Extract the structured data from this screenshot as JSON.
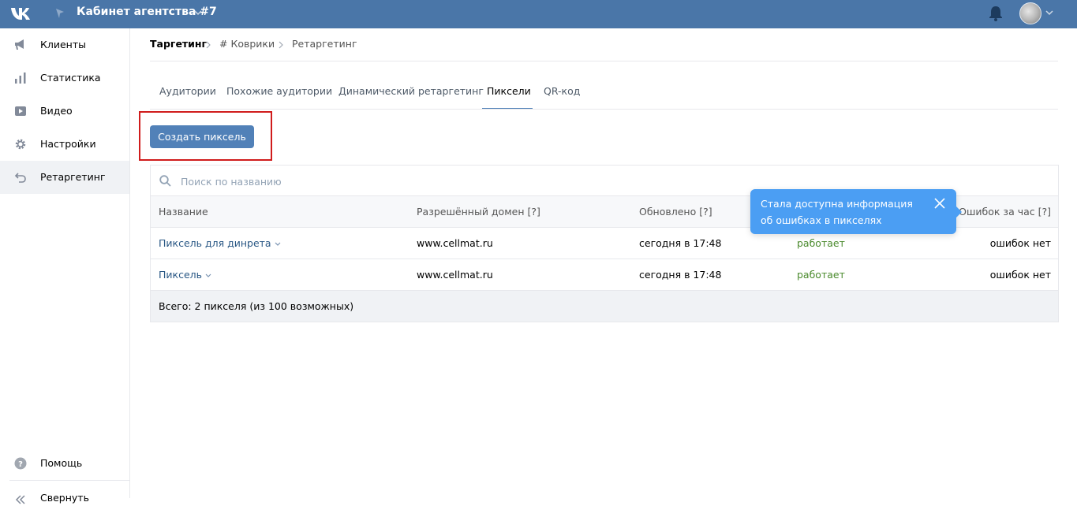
{
  "header": {
    "cabinet_title": "Кабинет агентства #7",
    "brand_color": "#4a76a8"
  },
  "sidebar": {
    "items": [
      {
        "label": "Клиенты",
        "icon": "megaphone-icon"
      },
      {
        "label": "Статистика",
        "icon": "bar-chart-icon"
      },
      {
        "label": "Видео",
        "icon": "video-play-icon"
      },
      {
        "label": "Настройки",
        "icon": "gear-icon"
      },
      {
        "label": "Ретаргетинг",
        "icon": "retarget-arrow-icon",
        "active": true
      }
    ],
    "help_label": "Помощь",
    "collapse_label": "Свернуть"
  },
  "breadcrumb": [
    "Таргетинг",
    "# Коврики",
    "Ретаргетинг"
  ],
  "tabs": [
    "Аудитории",
    "Похожие аудитории",
    "Динамический ретаргетинг",
    "Пиксели",
    "QR-код"
  ],
  "active_tab": "Пиксели",
  "create_button_label": "Создать пиксель",
  "search": {
    "placeholder": "Поиск по названию",
    "value": ""
  },
  "table": {
    "columns": [
      "Название",
      "Разрешённый домен [?]",
      "Обновлено [?]",
      "Ошибок за час [?]"
    ],
    "rows": [
      {
        "name": "Пиксель для динрета",
        "domain": "www.cellmat.ru",
        "updated": "сегодня в 17:48",
        "status": "работает",
        "errors": "ошибок нет"
      },
      {
        "name": "Пиксель",
        "domain": "www.cellmat.ru",
        "updated": "сегодня в 17:48",
        "status": "работает",
        "errors": "ошибок нет"
      }
    ],
    "footer": "Всего: 2 пикселя (из 100 возможных)"
  },
  "tooltip": {
    "text": "Стала доступна информация об ошибках в пикселях"
  }
}
